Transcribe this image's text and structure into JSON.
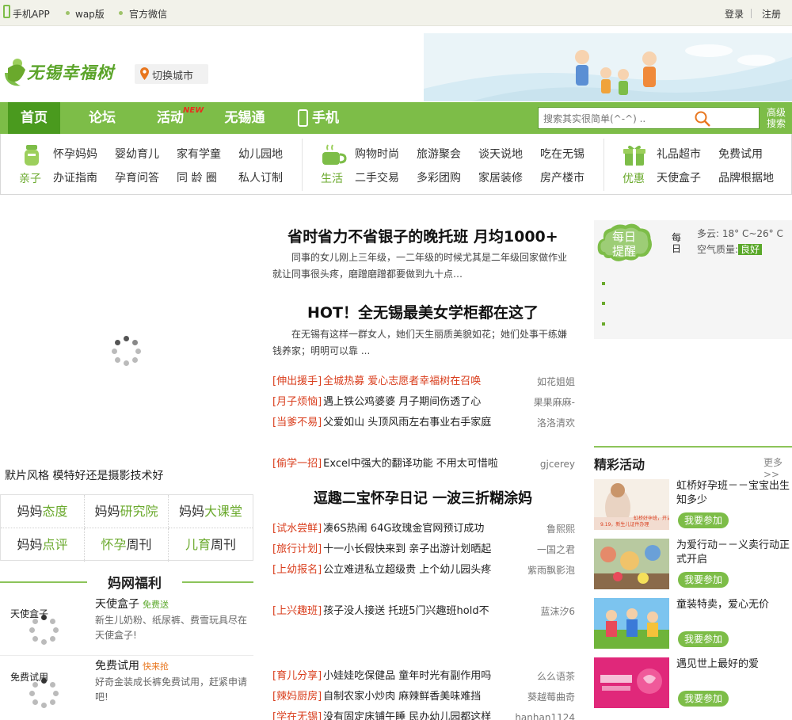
{
  "topbar": {
    "mobile_app": "手机APP",
    "wap": "wap版",
    "wechat": "官方微信",
    "login": "登录",
    "register": "注册"
  },
  "header": {
    "logo_text": "无锡幸福树",
    "switch_city": "切换城市"
  },
  "nav": {
    "items": [
      "首页",
      "论坛",
      "活动",
      "无锡通",
      "手机APP"
    ],
    "new_badge": "NEW",
    "search_placeholder": "搜索其实很简单(^-^) ..",
    "advanced": [
      "高级",
      "搜索"
    ]
  },
  "categories": {
    "groups": [
      {
        "name": "亲子",
        "links": [
          "怀孕妈妈",
          "婴幼育儿",
          "家有学童",
          "幼儿园地",
          "办证指南",
          "孕育问答",
          "同 龄 圈",
          "私人订制"
        ]
      },
      {
        "name": "生活",
        "links": [
          "购物时尚",
          "旅游聚会",
          "谈天说地",
          "吃在无锡",
          "二手交易",
          "多彩团购",
          "家居装修",
          "房产楼市"
        ]
      },
      {
        "name": "优惠",
        "links": [
          "礼品超市",
          "免费试用",
          "天使盒子",
          "品牌根据地"
        ]
      }
    ]
  },
  "left": {
    "slider_caption": "默片风格 模特好还是摄影技术好",
    "grid": [
      {
        "a": "妈妈",
        "b": "态度"
      },
      {
        "a": "妈妈",
        "b": "研究院"
      },
      {
        "a": "妈妈",
        "b": "大课堂"
      },
      {
        "a": "妈妈",
        "b": "点评"
      },
      {
        "a": "孕",
        "b": "周刊",
        "lead": "怀"
      },
      {
        "a": "育",
        "b": "周刊",
        "lead": "儿"
      }
    ],
    "fuli_title": "妈网福利",
    "fuli": [
      {
        "label": "天使盒子",
        "title": "天使盒子",
        "tag": "免费送",
        "desc": "新生儿奶粉、纸尿裤、费雪玩具尽在天使盒子!"
      },
      {
        "label": "免费试用",
        "title": "免费试用",
        "tag": "快来抢",
        "desc": "好奇金装成长裤免费试用，赶紧申请吧!"
      }
    ]
  },
  "middle": {
    "headline1": "省时省力不省银子的晚托班 月均1000+",
    "summary1": "同事的女儿刚上三年级，一二年级的时候尤其是二年级回家做作业就让同事很头疼，磨蹭磨蹭都要做到九十点…",
    "headline2": "HOT！全无锡最美女学柜都在这了",
    "summary2": "在无锡有这样一群女人，她们天生丽质美貌如花；她们处事干练嫌钱养家；明明可以靠 ...",
    "news_a": [
      {
        "tag": "[伸出援手]",
        "title": "全城热募 爱心志愿者幸福树在召唤",
        "author": "如花姐姐",
        "red": true
      },
      {
        "tag": "[月子烦恼]",
        "title": "遇上铁公鸡婆婆 月子期间伤透了心",
        "author": "果果麻麻-"
      },
      {
        "tag": "[当爹不易]",
        "title": "父爱如山 头顶风雨左右事业右手家庭",
        "author": "洛洛清欢"
      }
    ],
    "news_b": [
      {
        "tag": "[偷学一招]",
        "title": "Excel中强大的翻译功能 不用太可惜啦",
        "author": "gjcerey"
      }
    ],
    "headline3": "逗趣二宝怀孕日记 一波三折糊涂妈",
    "news_c": [
      {
        "tag": "[试水尝鲜]",
        "title": "凑6S热闹 64G玫瑰金官网预订成功",
        "author": "鲁熙熙"
      },
      {
        "tag": "[旅行计划]",
        "title": "十一小长假快来到 亲子出游计划晒起",
        "author": "一国之君"
      },
      {
        "tag": "[上幼报名]",
        "title": "公立难进私立超级贵 上个幼儿园头疼",
        "author": "紫雨飘影泡"
      }
    ],
    "news_d": [
      {
        "tag": "[上兴趣班]",
        "title": "孩子没人接送 托班5门兴趣班hold不",
        "author": "蓝沫汐6"
      }
    ],
    "news_e": [
      {
        "tag": "[育儿分享]",
        "title": "小娃娃吃保健品 童年时光有副作用吗",
        "author": "么么语茶"
      },
      {
        "tag": "[辣妈厨房]",
        "title": "自制农家小炒肉 麻辣鲜香美味难挡",
        "author": "葵越莓曲奇"
      },
      {
        "tag": "[学在无锡]",
        "title": "没有固定床铺午睡 民办幼儿园都这样",
        "author": "hanhan1124"
      }
    ]
  },
  "right": {
    "daily_badge": [
      "每日",
      "提醒"
    ],
    "daily_side": "每日",
    "weather": "多云: 18° C~26° C",
    "air_label": "空气质量:",
    "air_value": "良好",
    "activities_title": "精彩活动",
    "more": "更多>>",
    "join": "我要参加",
    "activities": [
      {
        "title": "虹桥好孕班－－宝宝出生知多少"
      },
      {
        "title": "为爱行动－－义卖行动正式开启"
      },
      {
        "title": "童装特卖，爱心无价"
      },
      {
        "title": "遇见世上最好的爱"
      }
    ],
    "banner_text_1": "虹桥好孕班，开讲啦～",
    "banner_text_2": "9.19，新生儿证件办理"
  },
  "colors": {
    "nav_green": "#7dbd48",
    "nav_active": "#4a9a1e",
    "accent_red": "#d93d1c",
    "link_green": "#6aa92c"
  }
}
